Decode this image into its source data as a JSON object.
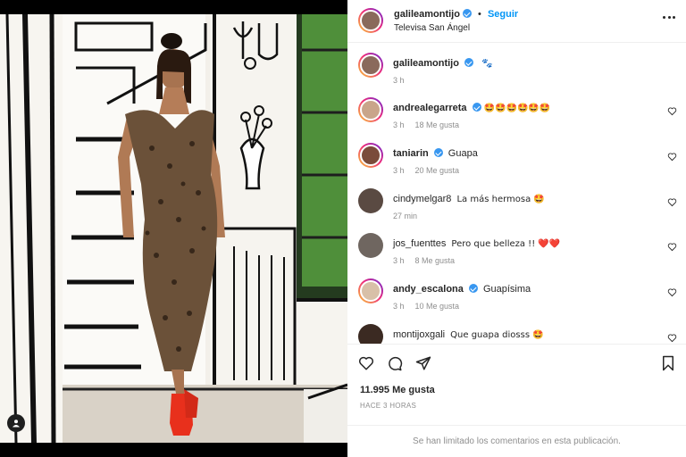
{
  "post": {
    "author": "galileamontijo",
    "verified": true,
    "follow_label": "Seguir",
    "separator": "•",
    "location": "Televisa San Ángel"
  },
  "caption": {
    "username": "galileamontijo",
    "text": "🐾",
    "time": "3 h"
  },
  "comments": [
    {
      "username": "andrealegarreta",
      "verified": true,
      "text": "🤩🤩🤩🤩🤩🤩",
      "time": "3 h",
      "likes": "18 Me gusta"
    },
    {
      "username": "taniarin",
      "verified": true,
      "text": "Guapa",
      "time": "3 h",
      "likes": "20 Me gusta"
    },
    {
      "username": "cindymelgar8",
      "verified": false,
      "text": "La más hermosa 🤩",
      "time": "27 min",
      "likes": ""
    },
    {
      "username": "jos_fuenttes",
      "verified": false,
      "text": "Pero que belleza !! ❤️❤️",
      "time": "3 h",
      "likes": "8 Me gusta"
    },
    {
      "username": "andy_escalona",
      "verified": true,
      "text": "Guapísima",
      "time": "3 h",
      "likes": "10 Me gusta"
    },
    {
      "username": "montijoxgali",
      "verified": false,
      "text": "Que guapa diosss 🤩",
      "time": "",
      "likes": ""
    }
  ],
  "footer": {
    "likes": "11.995 Me gusta",
    "posted_ago": "HACE 3 HORAS",
    "comments_limited": "Se han limitado los comentarios en esta publicación."
  },
  "icons": {
    "like": "heart-icon",
    "comment": "comment-icon",
    "share": "share-icon",
    "save": "bookmark-icon",
    "options": "more-options-icon",
    "tag": "user-tag-icon"
  },
  "colors": {
    "link_blue": "#0095f6",
    "verified_blue": "#3897f0",
    "muted_text": "#8e8e8e",
    "dress_red_shoes": "#e8301c"
  }
}
